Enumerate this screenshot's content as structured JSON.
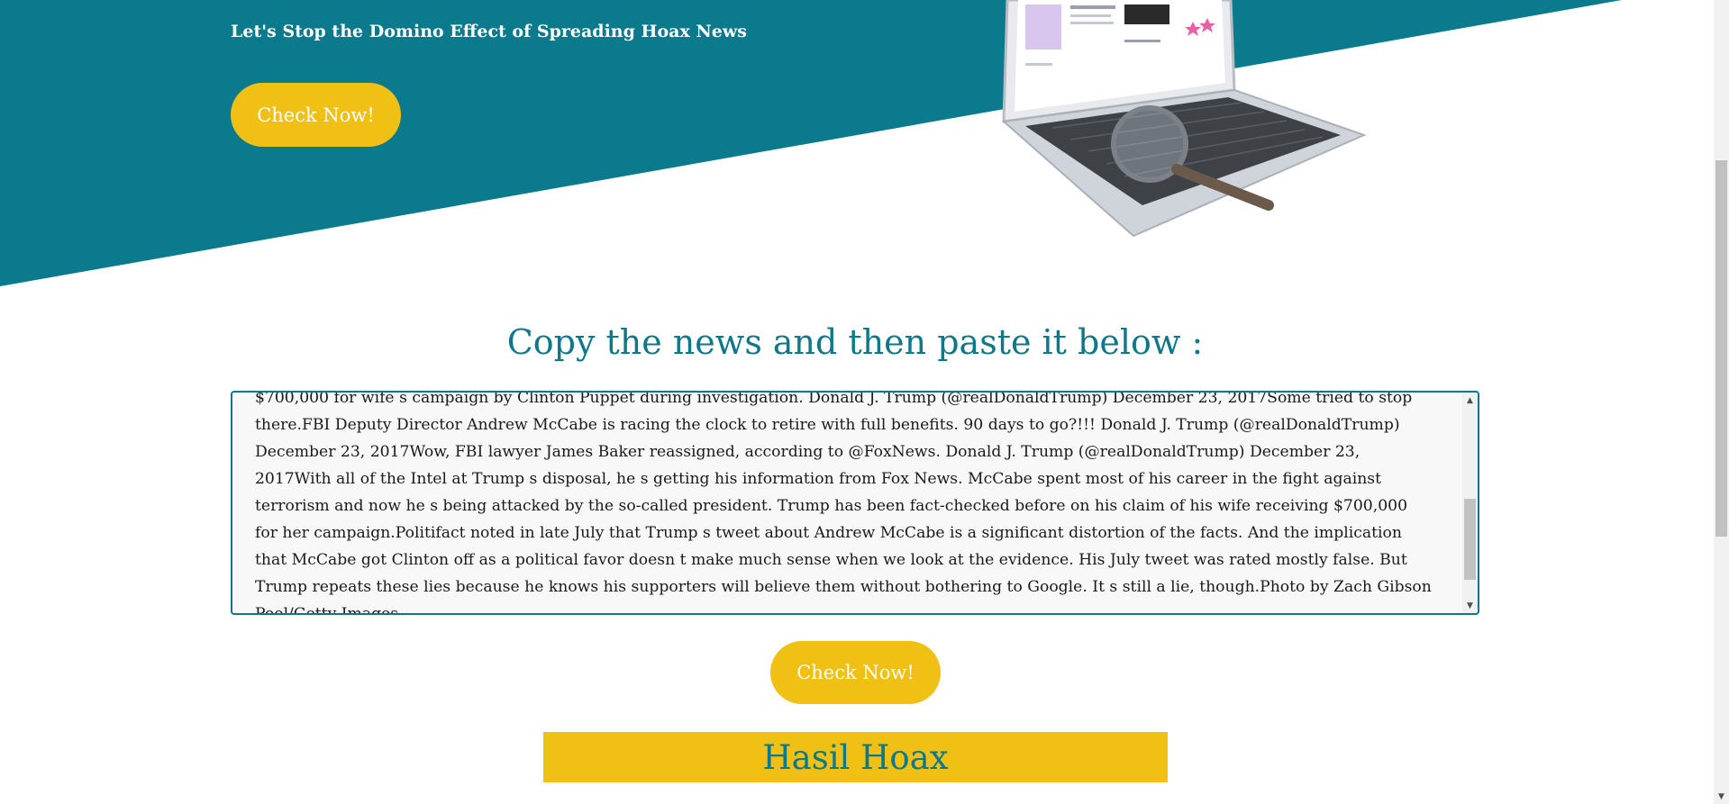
{
  "hero": {
    "tagline": "Let's Stop the Domino Effect of Spreading Hoax News",
    "check_button_label": "Check Now!",
    "illustration": "laptop-magnifier-illustration"
  },
  "main": {
    "section_title": "Copy the news and then paste it below :",
    "news_text": "$700,000 for wife s campaign by Clinton Puppet during investigation. Donald J. Trump (@realDonaldTrump) December 23, 2017Some tried to stop\nthere.FBI Deputy Director Andrew McCabe is racing the clock to retire with full benefits. 90 days to go?!!!  Donald J. Trump (@realDonaldTrump)\nDecember 23, 2017Wow,  FBI lawyer James Baker reassigned,  according to @FoxNews.  Donald J. Trump (@realDonaldTrump) December 23,\n2017With all of the Intel at Trump s disposal, he s getting his information from Fox News. McCabe spent most of his career in the fight against\nterrorism and now he s being attacked by the so-called president. Trump has been fact-checked before on his claim of his wife receiving $700,000\nfor her campaign.Politifact noted in late July that Trump s  tweet about Andrew McCabe is a significant distortion of the facts. And the implication\nthat McCabe got Clinton off as a political favor doesn t make much sense when we look at the evidence. His July tweet was rated  mostly false.  But\nTrump repeats these lies because he knows his supporters will believe them without bothering to Google. It s still a lie, though.Photo by Zach Gibson\nPool/Getty Images.",
    "check_button_label": "Check Now!",
    "result_title": "Hasil Hoax"
  },
  "colors": {
    "brand_teal": "#0a7a8c",
    "accent_yellow": "#f0c014"
  },
  "icons": {
    "scroll_up": "chevron-up-icon",
    "scroll_down": "chevron-down-icon"
  }
}
